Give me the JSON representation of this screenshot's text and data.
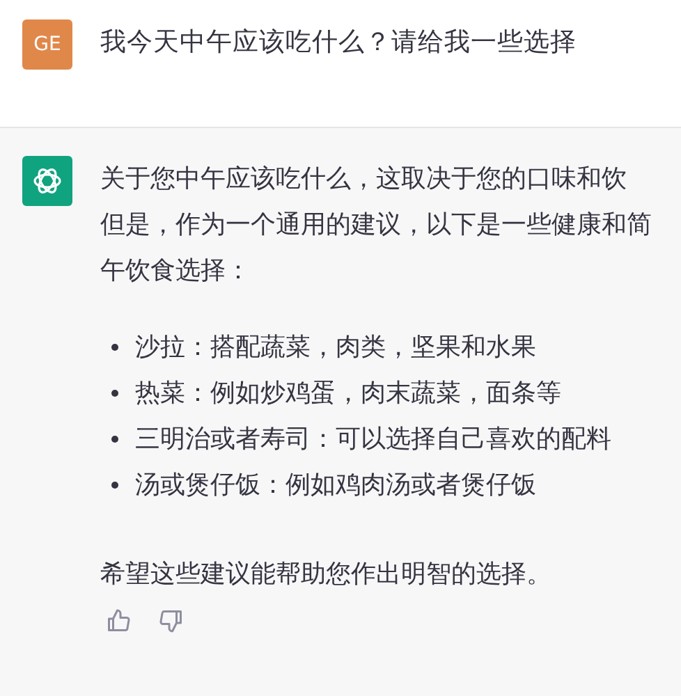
{
  "user_message": {
    "avatar": "GE",
    "text": "我今天中午应该吃什么？请给我一些选择"
  },
  "assistant_message": {
    "intro_lines": [
      "关于您中午应该吃什么，这取决于您的口味和饮",
      "但是，作为一个通用的建议，以下是一些健康和简",
      "午饮食选择："
    ],
    "bullets": [
      "沙拉：搭配蔬菜，肉类，坚果和水果",
      "热菜：例如炒鸡蛋，肉末蔬菜，面条等",
      "三明治或者寿司：可以选择自己喜欢的配料",
      "汤或煲仔饭：例如鸡肉汤或者煲仔饭"
    ],
    "closing": "希望这些建议能帮助您作出明智的选择。"
  }
}
